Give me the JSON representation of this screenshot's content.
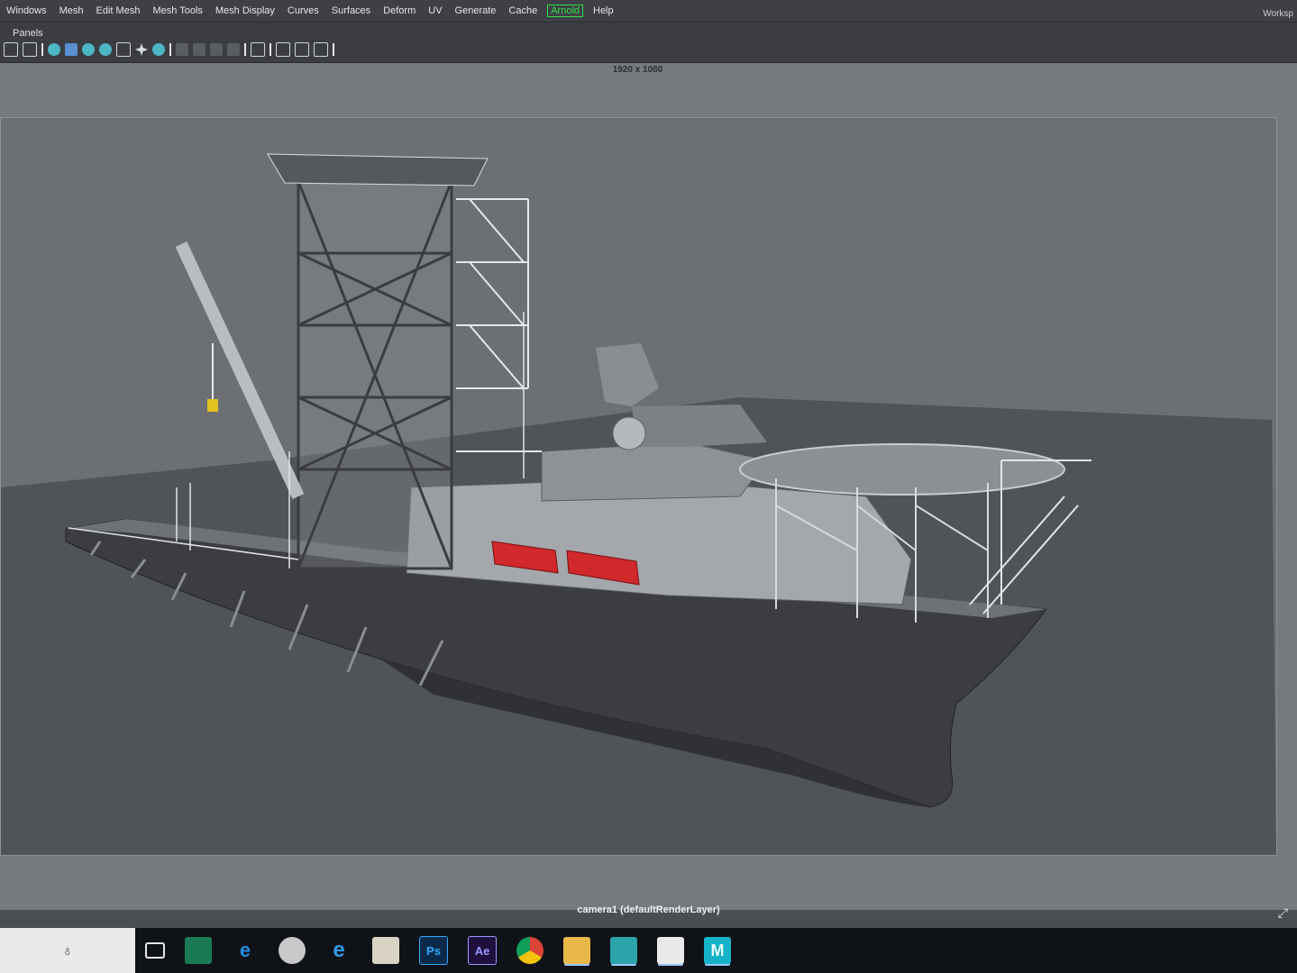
{
  "menubar": {
    "items": [
      "Windows",
      "Mesh",
      "Edit Mesh",
      "Mesh Tools",
      "Mesh Display",
      "Curves",
      "Surfaces",
      "Deform",
      "UV",
      "Generate",
      "Cache",
      "Arnold",
      "Help"
    ],
    "workspace_label": "Worksp"
  },
  "panelbar": {
    "label": "Panels"
  },
  "viewport": {
    "resolution": "1920 x 1080",
    "camera_label": "camera1 (defaultRenderLayer)"
  },
  "taskbar": {
    "icons": [
      "task-view-icon",
      "file-explorer-icon",
      "edge-icon",
      "snipping-tool-icon",
      "internet-explorer-icon",
      "calculator-icon",
      "photoshop-icon",
      "after-effects-icon",
      "chrome-icon",
      "folder-icon",
      "image-viewer-icon",
      "photos-icon",
      "maya-icon"
    ],
    "labels": {
      "photoshop": "Ps",
      "after_effects": "Ae",
      "maya": "M"
    }
  },
  "colors": {
    "arnold_accent": "#2ee04a",
    "hull": "#3b3d42",
    "lifeboat": "#d1282b",
    "scene_background": "#6c7075"
  }
}
